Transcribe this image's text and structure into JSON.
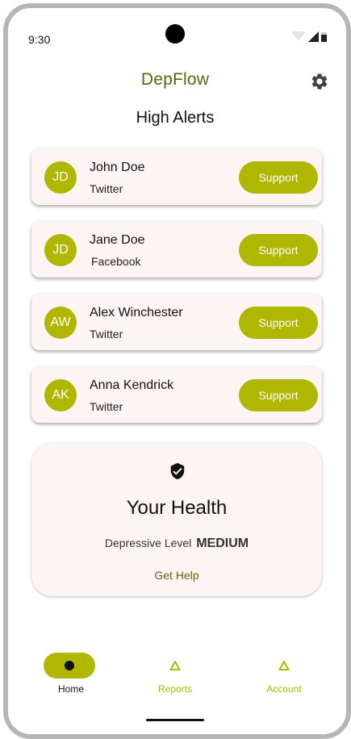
{
  "status": {
    "time": "9:30"
  },
  "header": {
    "app_title": "DepFlow",
    "page_title": "High Alerts"
  },
  "alerts": [
    {
      "initials": "JD",
      "name": "John Doe",
      "source": "Twitter",
      "action": "Support"
    },
    {
      "initials": "JD",
      "name": "Jane Doe",
      "source": "Facebook",
      "action": "Support"
    },
    {
      "initials": "AW",
      "name": "Alex Winchester",
      "source": "Twitter",
      "action": "Support"
    },
    {
      "initials": "AK",
      "name": "Anna Kendrick",
      "source": "Twitter",
      "action": "Support"
    }
  ],
  "health": {
    "title": "Your Health",
    "level_label": "Depressive Level",
    "level_value": "MEDIUM",
    "action": "Get Help",
    "icon": "shield-check-icon"
  },
  "nav": [
    {
      "label": "Home",
      "icon": "dot-icon",
      "active": true
    },
    {
      "label": "Reports",
      "icon": "triangle-icon",
      "active": false
    },
    {
      "label": "Account",
      "icon": "triangle-icon",
      "active": false
    }
  ],
  "colors": {
    "accent": "#afb700",
    "title": "#5b6407",
    "card_bg": "#fdf4f4"
  }
}
